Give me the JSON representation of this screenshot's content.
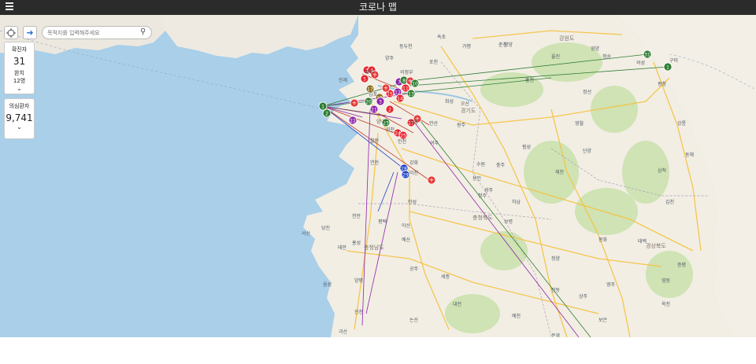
{
  "header": {
    "title": "코로나 맵"
  },
  "controls": {
    "search_placeholder": "목적지를 입력해주세요",
    "locate_icon": "crosshair-icon",
    "route_icon": "arrow-right-icon",
    "search_icon": "magnifier-icon"
  },
  "stats": {
    "confirmed_label": "확진자",
    "confirmed_value": "31",
    "recovered_label": "완치",
    "recovered_value": "12명",
    "suspected_label": "의심환자",
    "suspected_value": "9,741"
  },
  "map": {
    "place_labels": [
      "강원도",
      "경기도",
      "충청북도",
      "충청남도",
      "경상북도",
      "김포",
      "파주",
      "의정부",
      "양주",
      "동두천",
      "포천",
      "가평",
      "춘천",
      "홍천",
      "횡성",
      "원주",
      "여주",
      "이천",
      "안성",
      "평택",
      "아산",
      "천안",
      "당진",
      "서산",
      "태안",
      "홍성",
      "예산",
      "공주",
      "세종",
      "대전",
      "논산",
      "청주",
      "충주",
      "제천",
      "단양",
      "영월",
      "정선",
      "평창",
      "강릉",
      "동해",
      "삼척",
      "태백",
      "봉화",
      "영주",
      "안동",
      "상주",
      "문경",
      "예천",
      "보은",
      "옥천",
      "영동",
      "김천",
      "구미",
      "의성",
      "청송",
      "영양",
      "울진",
      "양양",
      "속초",
      "인제",
      "양구",
      "화천",
      "철원",
      "연천",
      "강화",
      "인천",
      "시흥",
      "안산",
      "화성",
      "오산",
      "용인",
      "수원",
      "광주",
      "하남",
      "양평",
      "음성",
      "진천",
      "괴산",
      "증평",
      "청양",
      "보령",
      "부여",
      "서천",
      "영덕",
      "공주시",
      "단양군"
    ],
    "marker_colors": {
      "red": "#e8242b",
      "green": "#2e7d32",
      "purple": "#8e24aa",
      "blue": "#1e40c8",
      "brown": "#8d6e1f",
      "hospital": "#e53935"
    },
    "markers": [
      "1",
      "2",
      "3",
      "4",
      "5",
      "6",
      "7",
      "8",
      "9",
      "10",
      "11",
      "12",
      "13",
      "14",
      "15",
      "16",
      "17",
      "18",
      "19",
      "20",
      "21",
      "22",
      "23",
      "24",
      "25",
      "26",
      "27",
      "28",
      "29",
      "30",
      "31"
    ]
  }
}
